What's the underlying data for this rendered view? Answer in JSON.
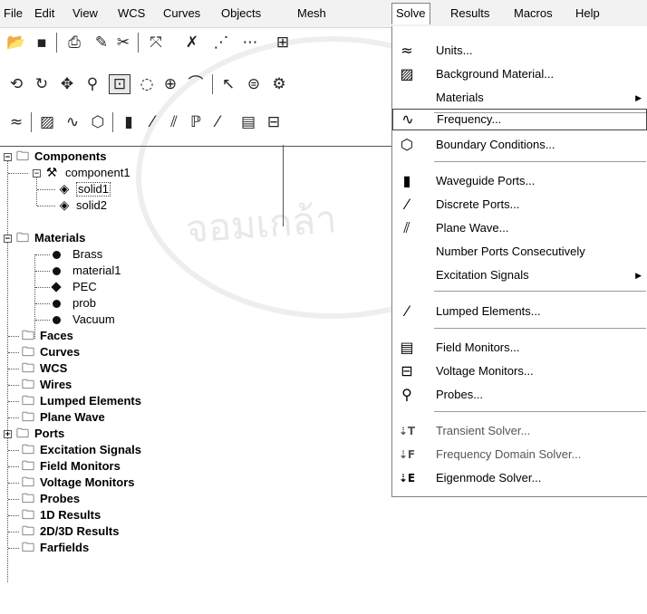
{
  "menubar": {
    "items": [
      "File",
      "Edit",
      "View",
      "WCS",
      "Curves",
      "Objects",
      "Mesh",
      "Solve",
      "Results",
      "Macros",
      "Help"
    ],
    "active": "Solve"
  },
  "toolbars": [
    [
      "open-icon",
      "save-icon",
      "print-icon",
      "properties-icon",
      "cut-icon",
      "transform-icon",
      "pick-icon",
      "pick-edge-icon",
      "macro-icon"
    ],
    [
      "rotate-icon",
      "rotate-view-icon",
      "pan-icon",
      "move-icon",
      "zoom-box-icon",
      "lasso-icon",
      "zoom-icon",
      "fit-icon",
      "cursor-icon",
      "wire-icon",
      "mesh-icon"
    ],
    [
      "units-icon",
      "background-icon",
      "frequency-icon",
      "boundary-icon",
      "waveguide-port-icon",
      "discrete-port-icon",
      "plane-wave-icon",
      "excitation-icon",
      "lumped-icon",
      "field-monitor-icon",
      "voltage-monitor-icon"
    ]
  ],
  "tree": {
    "components": {
      "label": "Components",
      "children": [
        {
          "label": "component1",
          "children": [
            "solid1",
            "solid2"
          ]
        }
      ]
    },
    "materials": {
      "label": "Materials",
      "children": [
        "Brass",
        "material1",
        "PEC",
        "prob",
        "Vacuum"
      ]
    },
    "folders": [
      "Faces",
      "Curves",
      "WCS",
      "Wires",
      "Lumped Elements",
      "Plane Wave",
      "Ports",
      "Excitation Signals",
      "Field Monitors",
      "Voltage Monitors",
      "Probes",
      "1D Results",
      "2D/3D Results",
      "Farfields"
    ]
  },
  "solve_menu": {
    "items": [
      {
        "label": "Units...",
        "icon": "units-icon"
      },
      {
        "label": "Background Material...",
        "icon": "background-material-icon"
      },
      {
        "label": "Materials",
        "icon": "",
        "submenu": true
      },
      {
        "label": "Frequency...",
        "icon": "frequency-icon",
        "highlighted": true
      },
      {
        "label": "Boundary Conditions...",
        "icon": "boundary-conditions-icon"
      },
      {
        "label": "Waveguide Ports...",
        "icon": "waveguide-ports-icon"
      },
      {
        "label": "Discrete Ports...",
        "icon": "discrete-ports-icon"
      },
      {
        "label": "Plane Wave...",
        "icon": "plane-wave-icon"
      },
      {
        "label": "Number Ports Consecutively",
        "icon": ""
      },
      {
        "label": "Excitation Signals",
        "icon": "",
        "submenu": true
      },
      {
        "label": "Lumped Elements...",
        "icon": "lumped-elements-icon"
      },
      {
        "label": "Field Monitors...",
        "icon": "field-monitors-icon"
      },
      {
        "label": "Voltage Monitors...",
        "icon": "voltage-monitors-icon"
      },
      {
        "label": "Probes...",
        "icon": "probes-icon"
      },
      {
        "label": "Transient Solver...",
        "icon": "transient-solver-icon"
      },
      {
        "label": "Frequency Domain Solver...",
        "icon": "frequency-domain-solver-icon"
      },
      {
        "label": "Eigenmode Solver...",
        "icon": "eigenmode-solver-icon"
      }
    ]
  },
  "colors": {
    "background": "#ffffff",
    "menubar": "#f2f2f2",
    "folder": "#9a9a9a"
  }
}
